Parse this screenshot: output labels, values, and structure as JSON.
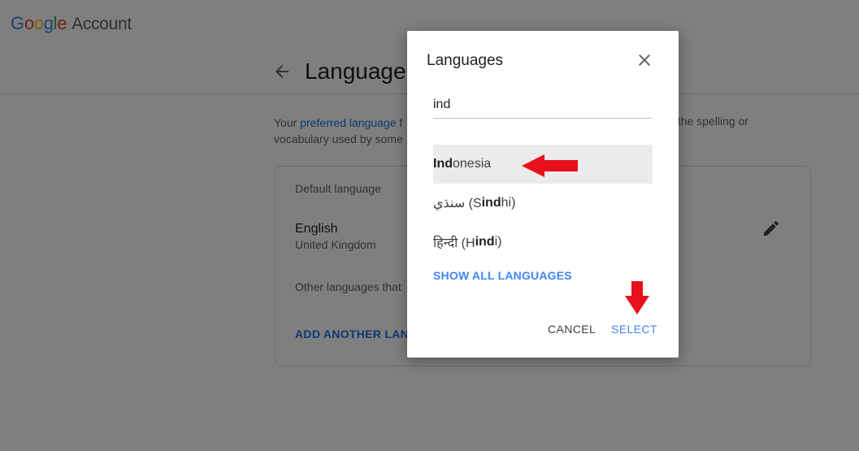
{
  "brand": {
    "letters": [
      "G",
      "o",
      "o",
      "g",
      "l",
      "e"
    ],
    "product": "Account"
  },
  "page": {
    "title": "Language",
    "intro_prefix": "Your ",
    "intro_link": "preferred language",
    "intro_mid": " f",
    "intro_line2": "vocabulary used by some",
    "intro_right": "t the spelling or"
  },
  "card": {
    "default_label": "Default language",
    "language": "English",
    "region": "United Kingdom",
    "other_label": "Other languages that",
    "add_link": "ADD ANOTHER LANG"
  },
  "dialog": {
    "title": "Languages",
    "search_value": "ind",
    "options": [
      {
        "pre": "",
        "bold": "Ind",
        "post": "onesia",
        "selected": true
      },
      {
        "pre": "سنڌي (S",
        "bold": "ind",
        "post": "hi)",
        "selected": false
      },
      {
        "pre": "हिन्दी (H",
        "bold": "ind",
        "post": "i)",
        "selected": false
      }
    ],
    "show_all": "SHOW ALL LANGUAGES",
    "cancel": "CANCEL",
    "select": "SELECT"
  },
  "colors": {
    "accent": "#4285f4",
    "link": "#1a73e8",
    "annotation_arrow": "#e8101a",
    "selected_row": "#ebebeb"
  },
  "icons": [
    "back-arrow-icon",
    "edit-pencil-icon",
    "close-icon",
    "annotation-arrow-left-icon",
    "annotation-arrow-down-icon"
  ]
}
